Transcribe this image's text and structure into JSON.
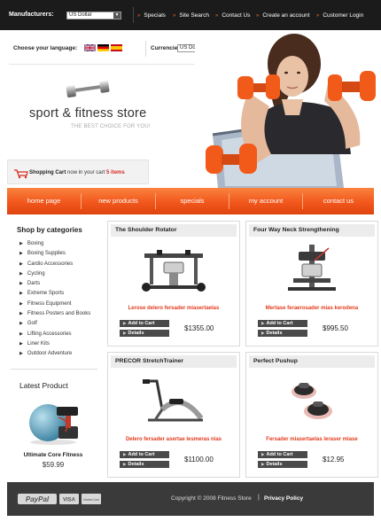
{
  "topbar": {
    "manufacturers_label": "Manufacturers:",
    "manufacturers_value": "US Dollar",
    "links": [
      "Specials",
      "Site Search",
      "Contact Us",
      "Create an account",
      "Customer Login"
    ]
  },
  "header": {
    "language_label": "Choose your language:",
    "currencies_label": "Currencies:",
    "currency_value": "US Dollar",
    "store_name": "sport & fitness store",
    "tagline": "THE BEST CHOICE FOR YOU!"
  },
  "cart": {
    "label": "Shopping Cart",
    "text": "now in your cart",
    "count": "5 items"
  },
  "nav": [
    "home page",
    "new products",
    "specials",
    "my account",
    "contact us"
  ],
  "sidebar": {
    "title": "Shop by categories",
    "categories": [
      "Boxing",
      "Boxing Supplies",
      "Cardio Accessories",
      "Cycling",
      "Darts",
      "Extreme Sports",
      "Fitness Equipment",
      "Fitness Posters and Books",
      "Golf",
      "Lifting Accessories",
      "Liner Kits",
      "Outdoor Adventure"
    ],
    "latest_title": "Latest Product",
    "latest_name": "Ultimate Core Fitness",
    "latest_price": "$59.99"
  },
  "buttons": {
    "add_to_cart": "Add to Cart",
    "details": "Details"
  },
  "products": [
    {
      "title": "The Shoulder Rotator",
      "desc": "Lerose delero fersader miasertaelas",
      "price": "$1355.00"
    },
    {
      "title": "Four Way Neck Strengthening",
      "desc": "Mertase feraerosader mias kerodena",
      "price": "$995.50"
    },
    {
      "title": "PRECOR StretchTrainer",
      "desc": "Delero fersader asertae lesmeras nias",
      "price": "$1100.00"
    },
    {
      "title": "Perfect Pushup",
      "desc": "Fersader miasertaelas leraser miase",
      "price": "$12.95"
    }
  ],
  "footer": {
    "copyright": "Copyright © 2008 Fitness Store",
    "separator": "|",
    "privacy": "Privacy Policy",
    "paypal": "PayPal",
    "visa": "VISA",
    "mastercard": "MasterCard"
  },
  "colors": {
    "accent": "#f26522",
    "topbar": "#1b1b1b",
    "footer": "#3a3a3a",
    "price_red": "#e33b1e"
  }
}
